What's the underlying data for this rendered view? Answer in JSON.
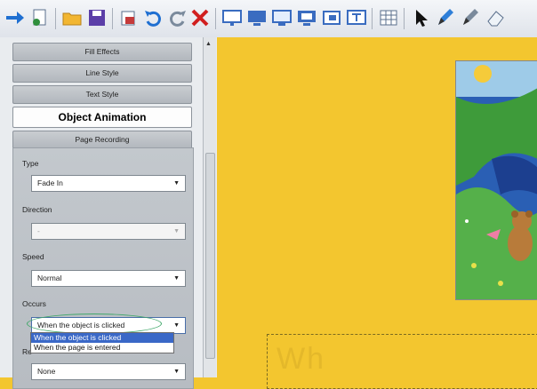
{
  "toolbar": {
    "icons": [
      "forward-arrow-icon",
      "new-page-icon",
      "open-folder-icon",
      "save-icon",
      "print-icon",
      "undo-icon",
      "redo-icon",
      "delete-icon",
      "screen-shade-icon",
      "monitor-icon",
      "monitor-2-icon",
      "monitor-3-icon",
      "camera-icon",
      "text-tool-icon",
      "table-icon",
      "select-arrow-icon",
      "pen-icon",
      "creative-pen-icon",
      "eraser-icon"
    ]
  },
  "panel": {
    "sections": [
      {
        "label": "Fill Effects"
      },
      {
        "label": "Line Style"
      },
      {
        "label": "Text Style"
      },
      {
        "label": "Object Animation"
      },
      {
        "label": "Page Recording"
      }
    ],
    "type_label": "Type",
    "type_value": "Fade In",
    "direction_label": "Direction",
    "direction_value": "-",
    "speed_label": "Speed",
    "speed_value": "Normal",
    "occurs_label": "Occurs",
    "occurs_value": "When the object is clicked",
    "occurs_options": [
      "When the object is clicked",
      "When the page is entered"
    ],
    "repeat_label": "Re",
    "repeat_value": "None"
  },
  "canvas": {
    "ghost_text": "Wh"
  },
  "colors": {
    "canvas_bg": "#f3c62f",
    "highlight": "#3a68c7",
    "oval": "#41a86a"
  }
}
